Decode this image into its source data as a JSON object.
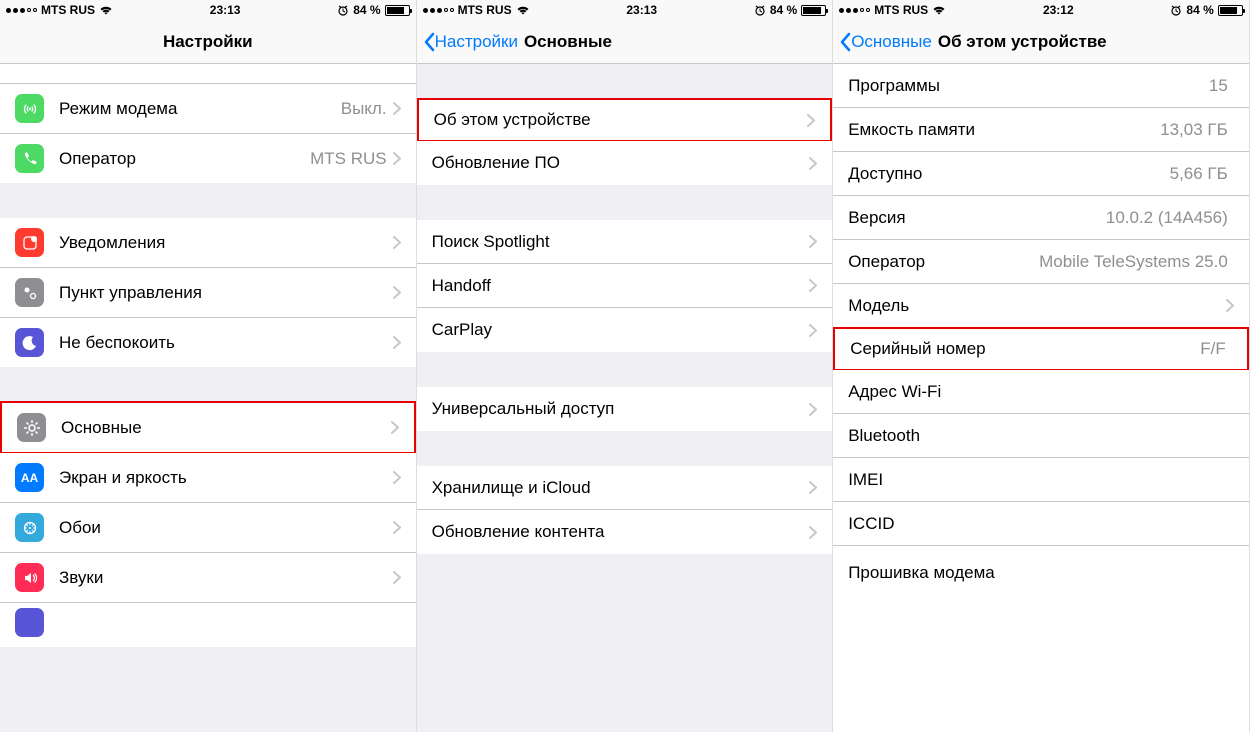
{
  "statusbar": {
    "carrier": "MTS RUS",
    "time1": "23:13",
    "time2": "23:13",
    "time3": "23:12",
    "battery": "84 %"
  },
  "screen1": {
    "title": "Настройки",
    "rows": {
      "hotspot": "Режим модема",
      "hotspot_val": "Выкл.",
      "carrier": "Оператор",
      "carrier_val": "MTS RUS",
      "notifications": "Уведомления",
      "control": "Пункт управления",
      "dnd": "Не беспокоить",
      "general": "Основные",
      "display": "Экран и яркость",
      "wallpaper": "Обои",
      "sounds": "Звуки"
    }
  },
  "screen2": {
    "back": "Настройки",
    "title": "Основные",
    "rows": {
      "about": "Об этом устройстве",
      "update": "Обновление ПО",
      "spotlight": "Поиск Spotlight",
      "handoff": "Handoff",
      "carplay": "CarPlay",
      "accessibility": "Универсальный доступ",
      "storage": "Хранилище и iCloud",
      "refresh": "Обновление контента"
    }
  },
  "screen3": {
    "back": "Основные",
    "title": "Об этом устройстве",
    "rows": {
      "apps": "Программы",
      "apps_val": "15",
      "capacity": "Емкость памяти",
      "capacity_val": "13,03 ГБ",
      "available": "Доступно",
      "available_val": "5,66 ГБ",
      "version": "Версия",
      "version_val": "10.0.2 (14A456)",
      "operator": "Оператор",
      "operator_val": "Mobile TeleSystems 25.0",
      "model": "Модель",
      "model_val": "",
      "serial": "Серийный номер",
      "serial_val": "F",
      "serial_val2": "/F",
      "wifi": "Адрес Wi‑Fi",
      "bt": "Bluetooth",
      "imei": "IMEI",
      "iccid": "ICCID",
      "modem": "Прошивка модема"
    }
  }
}
